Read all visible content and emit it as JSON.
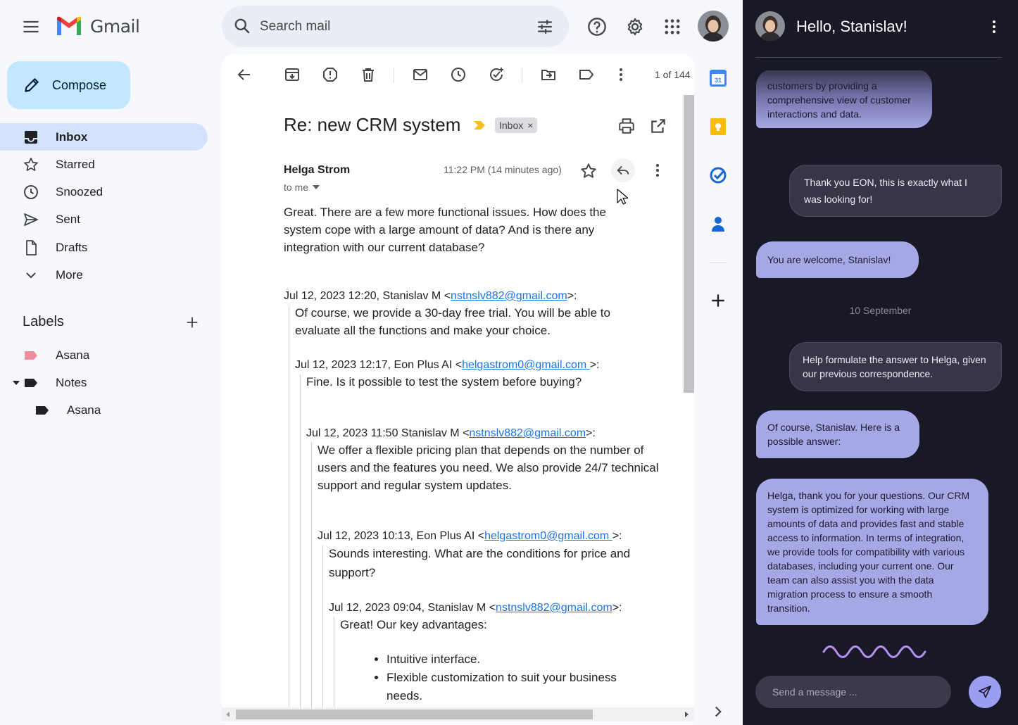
{
  "app": {
    "name": "Gmail"
  },
  "search": {
    "placeholder": "Search mail"
  },
  "compose": {
    "label": "Compose"
  },
  "nav": {
    "inbox": "Inbox",
    "starred": "Starred",
    "snoozed": "Snoozed",
    "sent": "Sent",
    "drafts": "Drafts",
    "more": "More"
  },
  "labels": {
    "title": "Labels",
    "items": [
      {
        "name": "Asana",
        "color": "#f28b9b"
      },
      {
        "name": "Notes",
        "color": "#202124"
      },
      {
        "name": "Asana",
        "color": "#202124"
      }
    ]
  },
  "toolbar": {
    "page_count": "1 of 144"
  },
  "email": {
    "subject": "Re: new CRM system",
    "chip": "Inbox",
    "chip_close": "×",
    "sender": "Helga Strom",
    "to": "to me",
    "time": "11:22 PM (14 minutes ago)",
    "body": "Great. There are a few more functional issues. How does the system cope with a large amount of data? And is there any integration with our current database?",
    "quotes": [
      {
        "header_pre": "Jul 12, 2023 12:20, Stanislav M <",
        "email": "nstnslv882@gmail.com",
        "header_post": ">:",
        "body": "Of course, we provide a 30-day free trial. You will be able to evaluate all the functions and make your choice."
      },
      {
        "header_pre": "Jul 12, 2023 12:17, Eon Plus AI <",
        "email": "helgastrom0@gmail.com ",
        "header_post": ">:",
        "body": "Fine. Is it possible to test the system before buying?"
      },
      {
        "header_pre": "Jul 12, 2023 11:50 Stanislav M <",
        "email": "nstnslv882@gmail.com",
        "header_post": ">:",
        "body": "We offer a flexible pricing plan that depends on the number of users and the features you need. We also provide 24/7 technical support and regular system updates."
      },
      {
        "header_pre": "Jul 12, 2023 10:13, Eon Plus AI <",
        "email": "helgastrom0@gmail.com ",
        "header_post": ">:",
        "body": "Sounds interesting. What are the conditions for price and support?"
      },
      {
        "header_pre": "Jul 12, 2023 09:04, Stanislav M <",
        "email": "nstnslv882@gmail.com",
        "header_post": ">:",
        "body": "Great! Our key advantages:"
      }
    ],
    "bullets": [
      "Intuitive interface.",
      "Flexible customization to suit your business needs."
    ]
  },
  "chat": {
    "title": "Hello, Stanislav!",
    "messages": [
      {
        "from": "bot",
        "text": "customers by providing a comprehensive view of customer interactions and data."
      },
      {
        "from": "user",
        "text": "Thank you EON, this is exactly what I was looking for!"
      },
      {
        "from": "bot",
        "text": "You are welcome, Stanislav!"
      },
      {
        "from": "user",
        "text": "Help formulate the answer to Helga, given our previous correspondence."
      },
      {
        "from": "bot",
        "text": "Of course, Stanislav. Here is a possible answer:"
      },
      {
        "from": "bot",
        "text": "Helga, thank you for your questions. Our CRM system is optimized for working with large amounts of data and provides fast and stable access to information. In terms of integration, we provide tools for compatibility with various databases, including your current one. Our team can also assist you with the data migration process to ensure a smooth transition."
      }
    ],
    "date_separator": "10 September",
    "input_placeholder": "Send a message ..."
  },
  "colors": {
    "compose_bg": "#c2e7ff",
    "nav_active": "#d3e3fd",
    "chat_bg": "#181827",
    "bot_bubble": "#a6a8e6",
    "user_bubble": "#373647",
    "link": "#1a73e8"
  }
}
